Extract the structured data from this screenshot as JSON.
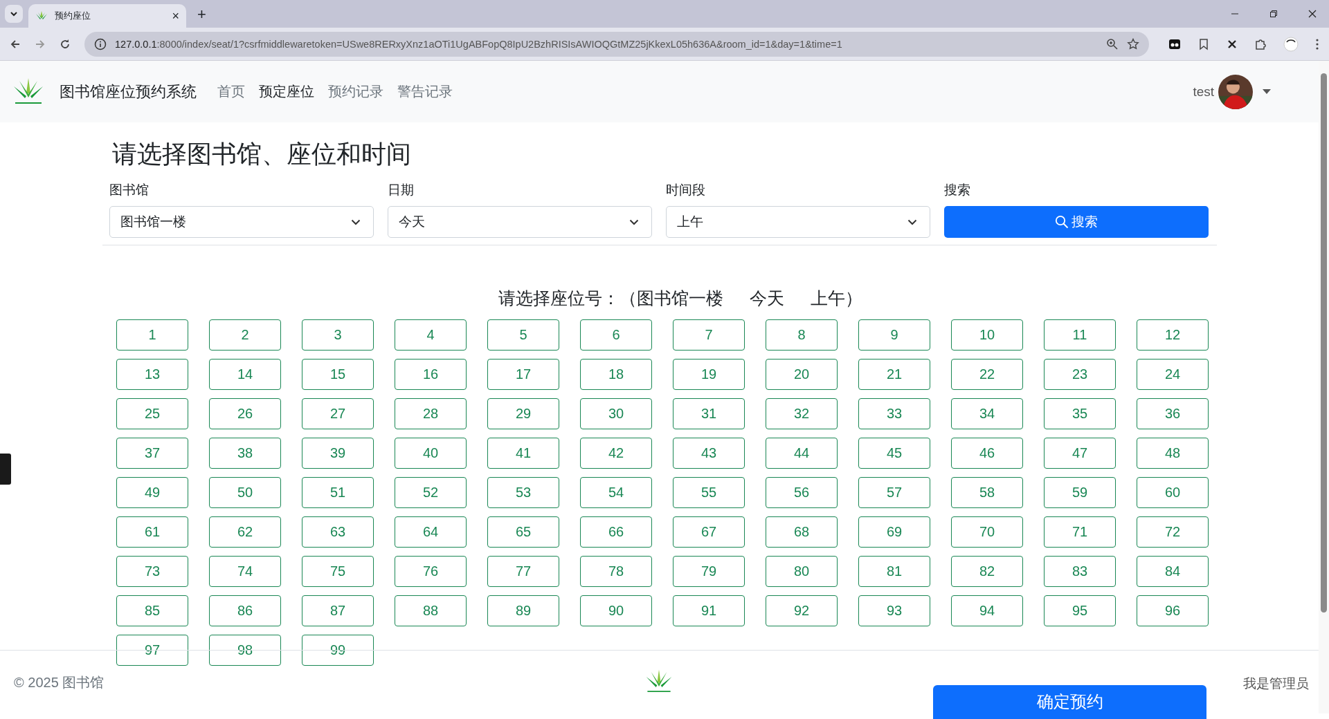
{
  "browser": {
    "tab_title": "预约座位",
    "tab_close": "×",
    "new_tab": "+",
    "url_host": "127.0.0.1",
    "url_rest": ":8000/index/seat/1?csrfmiddlewaretoken=USwe8RERxyXnz1aOTi1UgABFopQ8IpU2BzhRISIsAWIOQGtMZ25jKkexL05h636A&room_id=1&day=1&time=1"
  },
  "navbar": {
    "brand": "图书馆座位预约系统",
    "links": [
      {
        "label": "首页",
        "selected": false
      },
      {
        "label": "预定座位",
        "selected": true
      },
      {
        "label": "预约记录",
        "selected": false
      },
      {
        "label": "警告记录",
        "selected": false
      }
    ],
    "user": "test"
  },
  "title": "请选择图书馆、座位和时间",
  "filters": [
    {
      "kind": "select",
      "label": "图书馆",
      "value": "图书馆一楼"
    },
    {
      "kind": "select",
      "label": "日期",
      "value": "今天"
    },
    {
      "kind": "select",
      "label": "时间段",
      "value": "上午"
    },
    {
      "kind": "button",
      "label": "搜索",
      "value": "搜索"
    }
  ],
  "seat_heading": {
    "label": "请选择座位号：",
    "open": "（",
    "library": "图书馆一楼",
    "date": "今天",
    "period": "上午",
    "close": "）"
  },
  "seats": [
    "1",
    "2",
    "3",
    "4",
    "5",
    "6",
    "7",
    "8",
    "9",
    "10",
    "11",
    "12",
    "13",
    "14",
    "15",
    "16",
    "17",
    "18",
    "19",
    "20",
    "21",
    "22",
    "23",
    "24",
    "25",
    "26",
    "27",
    "28",
    "29",
    "30",
    "31",
    "32",
    "33",
    "34",
    "35",
    "36",
    "37",
    "38",
    "39",
    "40",
    "41",
    "42",
    "43",
    "44",
    "45",
    "46",
    "47",
    "48",
    "49",
    "50",
    "51",
    "52",
    "53",
    "54",
    "55",
    "56",
    "57",
    "58",
    "59",
    "60",
    "61",
    "62",
    "63",
    "64",
    "65",
    "66",
    "67",
    "68",
    "69",
    "70",
    "71",
    "72",
    "73",
    "74",
    "75",
    "76",
    "77",
    "78",
    "79",
    "80",
    "81",
    "82",
    "83",
    "84",
    "85",
    "86",
    "87",
    "88",
    "89",
    "90",
    "91",
    "92",
    "93",
    "94",
    "95",
    "96",
    "97",
    "98",
    "99"
  ],
  "footer": {
    "copyright": "© 2025 图书馆",
    "admin_link": "我是管理员",
    "confirm_button": "确定预约"
  }
}
